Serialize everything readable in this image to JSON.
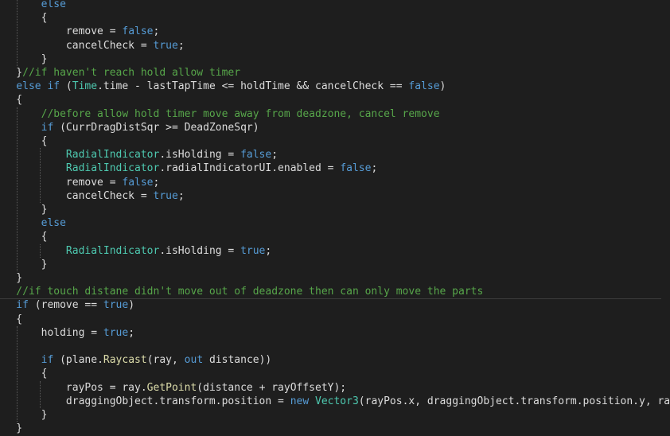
{
  "colors": {
    "background": "#1e1e1e",
    "text": "#dcdcdc",
    "keyword": "#569cd6",
    "type": "#4ec9b0",
    "comment": "#57a64a",
    "method": "#dcdcaa"
  },
  "lines": [
    [
      [
        "kw",
        "        else"
      ]
    ],
    [
      [
        "txt",
        "        {"
      ]
    ],
    [
      [
        "txt",
        "            remove = "
      ],
      [
        "kw",
        "false"
      ],
      [
        "txt",
        ";"
      ]
    ],
    [
      [
        "txt",
        "            cancelCheck = "
      ],
      [
        "kw",
        "true"
      ],
      [
        "txt",
        ";"
      ]
    ],
    [
      [
        "txt",
        "        }"
      ]
    ],
    [
      [
        "txt",
        "    }"
      ],
      [
        "cm",
        "//if haven't reach hold allow timer"
      ]
    ],
    [
      [
        "kw",
        "    else if"
      ],
      [
        "txt",
        " ("
      ],
      [
        "cls",
        "Time"
      ],
      [
        "txt",
        ".time - lastTapTime <= holdTime && cancelCheck == "
      ],
      [
        "kw",
        "false"
      ],
      [
        "txt",
        ")"
      ]
    ],
    [
      [
        "txt",
        "    {"
      ]
    ],
    [
      [
        "cm",
        "        //before allow hold timer move away from deadzone, cancel remove"
      ]
    ],
    [
      [
        "kw",
        "        if"
      ],
      [
        "txt",
        " (CurrDragDistSqr >= DeadZoneSqr)"
      ]
    ],
    [
      [
        "txt",
        "        {"
      ]
    ],
    [
      [
        "cls",
        "            RadialIndicator"
      ],
      [
        "txt",
        ".isHolding = "
      ],
      [
        "kw",
        "false"
      ],
      [
        "txt",
        ";"
      ]
    ],
    [
      [
        "cls",
        "            RadialIndicator"
      ],
      [
        "txt",
        ".radialIndicatorUI.enabled = "
      ],
      [
        "kw",
        "false"
      ],
      [
        "txt",
        ";"
      ]
    ],
    [
      [
        "txt",
        "            remove = "
      ],
      [
        "kw",
        "false"
      ],
      [
        "txt",
        ";"
      ]
    ],
    [
      [
        "txt",
        "            cancelCheck = "
      ],
      [
        "kw",
        "true"
      ],
      [
        "txt",
        ";"
      ]
    ],
    [
      [
        "txt",
        "        }"
      ]
    ],
    [
      [
        "kw",
        "        else"
      ]
    ],
    [
      [
        "txt",
        "        {"
      ]
    ],
    [
      [
        "cls",
        "            RadialIndicator"
      ],
      [
        "txt",
        ".isHolding = "
      ],
      [
        "kw",
        "true"
      ],
      [
        "txt",
        ";"
      ]
    ],
    [
      [
        "txt",
        "        }"
      ]
    ],
    [
      [
        "txt",
        "    }"
      ]
    ],
    [
      [
        "cm",
        "    //if touch distane didn't move out of deadzone then can only move the parts"
      ]
    ],
    [
      [
        "kw",
        "    if"
      ],
      [
        "txt",
        " (remove == "
      ],
      [
        "kw",
        "true"
      ],
      [
        "txt",
        ")"
      ]
    ],
    [
      [
        "txt",
        "    {"
      ]
    ],
    [
      [
        "txt",
        "        holding = "
      ],
      [
        "kw",
        "true"
      ],
      [
        "txt",
        ";"
      ]
    ],
    [
      [
        "txt",
        ""
      ]
    ],
    [
      [
        "kw",
        "        if"
      ],
      [
        "txt",
        " (plane."
      ],
      [
        "fn",
        "Raycast"
      ],
      [
        "txt",
        "(ray, "
      ],
      [
        "kw",
        "out"
      ],
      [
        "txt",
        " distance))"
      ]
    ],
    [
      [
        "txt",
        "        {"
      ]
    ],
    [
      [
        "txt",
        "            rayPos = ray."
      ],
      [
        "fn",
        "GetPoint"
      ],
      [
        "txt",
        "(distance + rayOffsetY);"
      ]
    ],
    [
      [
        "txt",
        "            draggingObject.transform.position = "
      ],
      [
        "kw",
        "new"
      ],
      [
        "txt",
        " "
      ],
      [
        "cls",
        "Vector3"
      ],
      [
        "txt",
        "(rayPos.x, draggingObject.transform.position.y, rayPos.z);"
      ]
    ],
    [
      [
        "txt",
        "        }"
      ]
    ],
    [
      [
        "txt",
        "    }"
      ]
    ]
  ]
}
